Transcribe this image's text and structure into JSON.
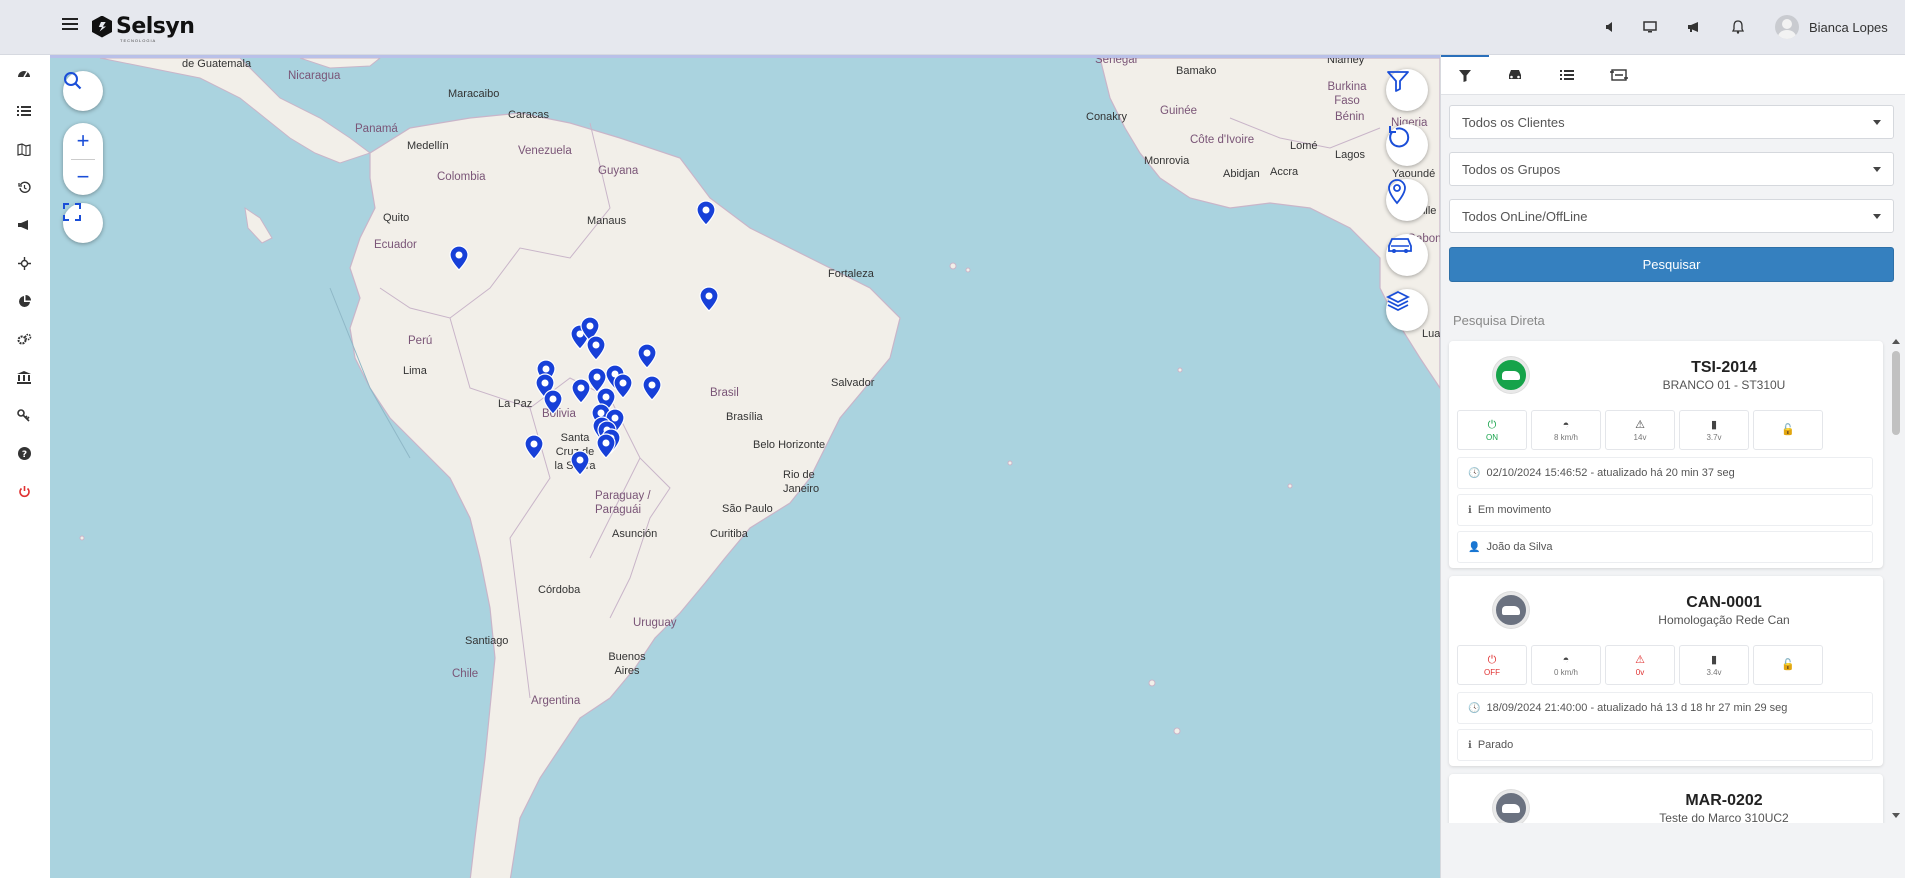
{
  "app": {
    "brand": "Selsyn",
    "brand_sub": "TECNOLOGIA"
  },
  "header": {
    "user_name": "Bianca Lopes",
    "icons": [
      "volume-icon",
      "monitor-icon",
      "megaphone-icon",
      "bell-icon"
    ]
  },
  "sidebar": {
    "items": [
      "dashboard-icon",
      "list-icon",
      "map-icon",
      "history-icon",
      "megaphone-icon",
      "crosshair-icon",
      "pie-chart-icon",
      "settings-icon",
      "bank-icon",
      "key-icon",
      "help-icon",
      "power-icon"
    ]
  },
  "map": {
    "labels": {
      "guatemala": "de Guatemala",
      "nicaragua": "Nicaragua",
      "panama": "Panamá",
      "maracaibo": "Maracaibo",
      "caracas": "Caracas",
      "venezuela": "Venezuela",
      "medellin": "Medellín",
      "colombia": "Colombia",
      "guyana": "Guyana",
      "quito": "Quito",
      "ecuador": "Ecuador",
      "manaus": "Manaus",
      "fortaleza": "Fortaleza",
      "peru": "Perú",
      "lima": "Lima",
      "la_paz": "La Paz",
      "bolivia": "Bolivia",
      "brasil": "Brasil",
      "brasilia": "Brasília",
      "salvador": "Salvador",
      "santa_cruz": "Santa Cruz de la Sierra",
      "belo_horizonte": "Belo Horizonte",
      "rio": "Rio de Janeiro",
      "sao_paulo": "São Paulo",
      "paraguay": "Paraguay / Paraguái",
      "asuncion": "Asunción",
      "curitiba": "Curitiba",
      "cordoba": "Córdoba",
      "uruguay": "Uruguay",
      "santiago": "Santiago",
      "chile": "Chile",
      "buenos_aires": "Buenos Aires",
      "argentina": "Argentina",
      "senegal": "Senegal",
      "bamako": "Bamako",
      "niamey": "Niamey",
      "burkina": "Burkina Faso",
      "conakry": "Conakry",
      "guinee": "Guinée",
      "benin": "Bénin",
      "nigeria": "Nigeria",
      "monrovia": "Monrovia",
      "cote": "Côte d'Ivoire",
      "lome": "Lomé",
      "lagos": "Lagos",
      "abidjan": "Abidjan",
      "accra": "Accra",
      "yaounde": "Yaoundé",
      "libreville": "Libreville",
      "gabon": "Gabon",
      "luanda": "Lua"
    },
    "zoom_in": "+",
    "zoom_out": "−",
    "controls": [
      "filter-icon",
      "refresh-icon",
      "location-pin-icon",
      "car-icon",
      "layers-icon"
    ]
  },
  "panel": {
    "tabs": [
      "filter-icon",
      "car-icon",
      "list-icon",
      "route-icon"
    ],
    "selects": {
      "clientes": "Todos os Clientes",
      "grupos": "Todos os Grupos",
      "online": "Todos OnLine/OffLine"
    },
    "search_button": "Pesquisar",
    "direct_search": "Pesquisa Direta",
    "vehicles": [
      {
        "plate": "TSI-2014",
        "description": "BRANCO 01 - ST310U",
        "status_color": "#16a34a",
        "ignition": "ON",
        "speed": "8 km/h",
        "voltage": "14v",
        "battery": "3.7v",
        "timestamp": "02/10/2024 15:46:52 - atualizado há 20 min 37 seg",
        "state": "Em movimento",
        "driver": "João da Silva"
      },
      {
        "plate": "CAN-0001",
        "description": "Homologação Rede Can",
        "status_color": "#6b7280",
        "ignition": "OFF",
        "speed": "0 km/h",
        "voltage": "0v",
        "battery": "3.4v",
        "timestamp": "18/09/2024 21:40:00 - atualizado há 13 d 18 hr 27 min 29 seg",
        "state": "Parado"
      },
      {
        "plate": "MAR-0202",
        "description": "Teste do Marco 310UC2",
        "status_color": "#6b7280"
      }
    ]
  }
}
